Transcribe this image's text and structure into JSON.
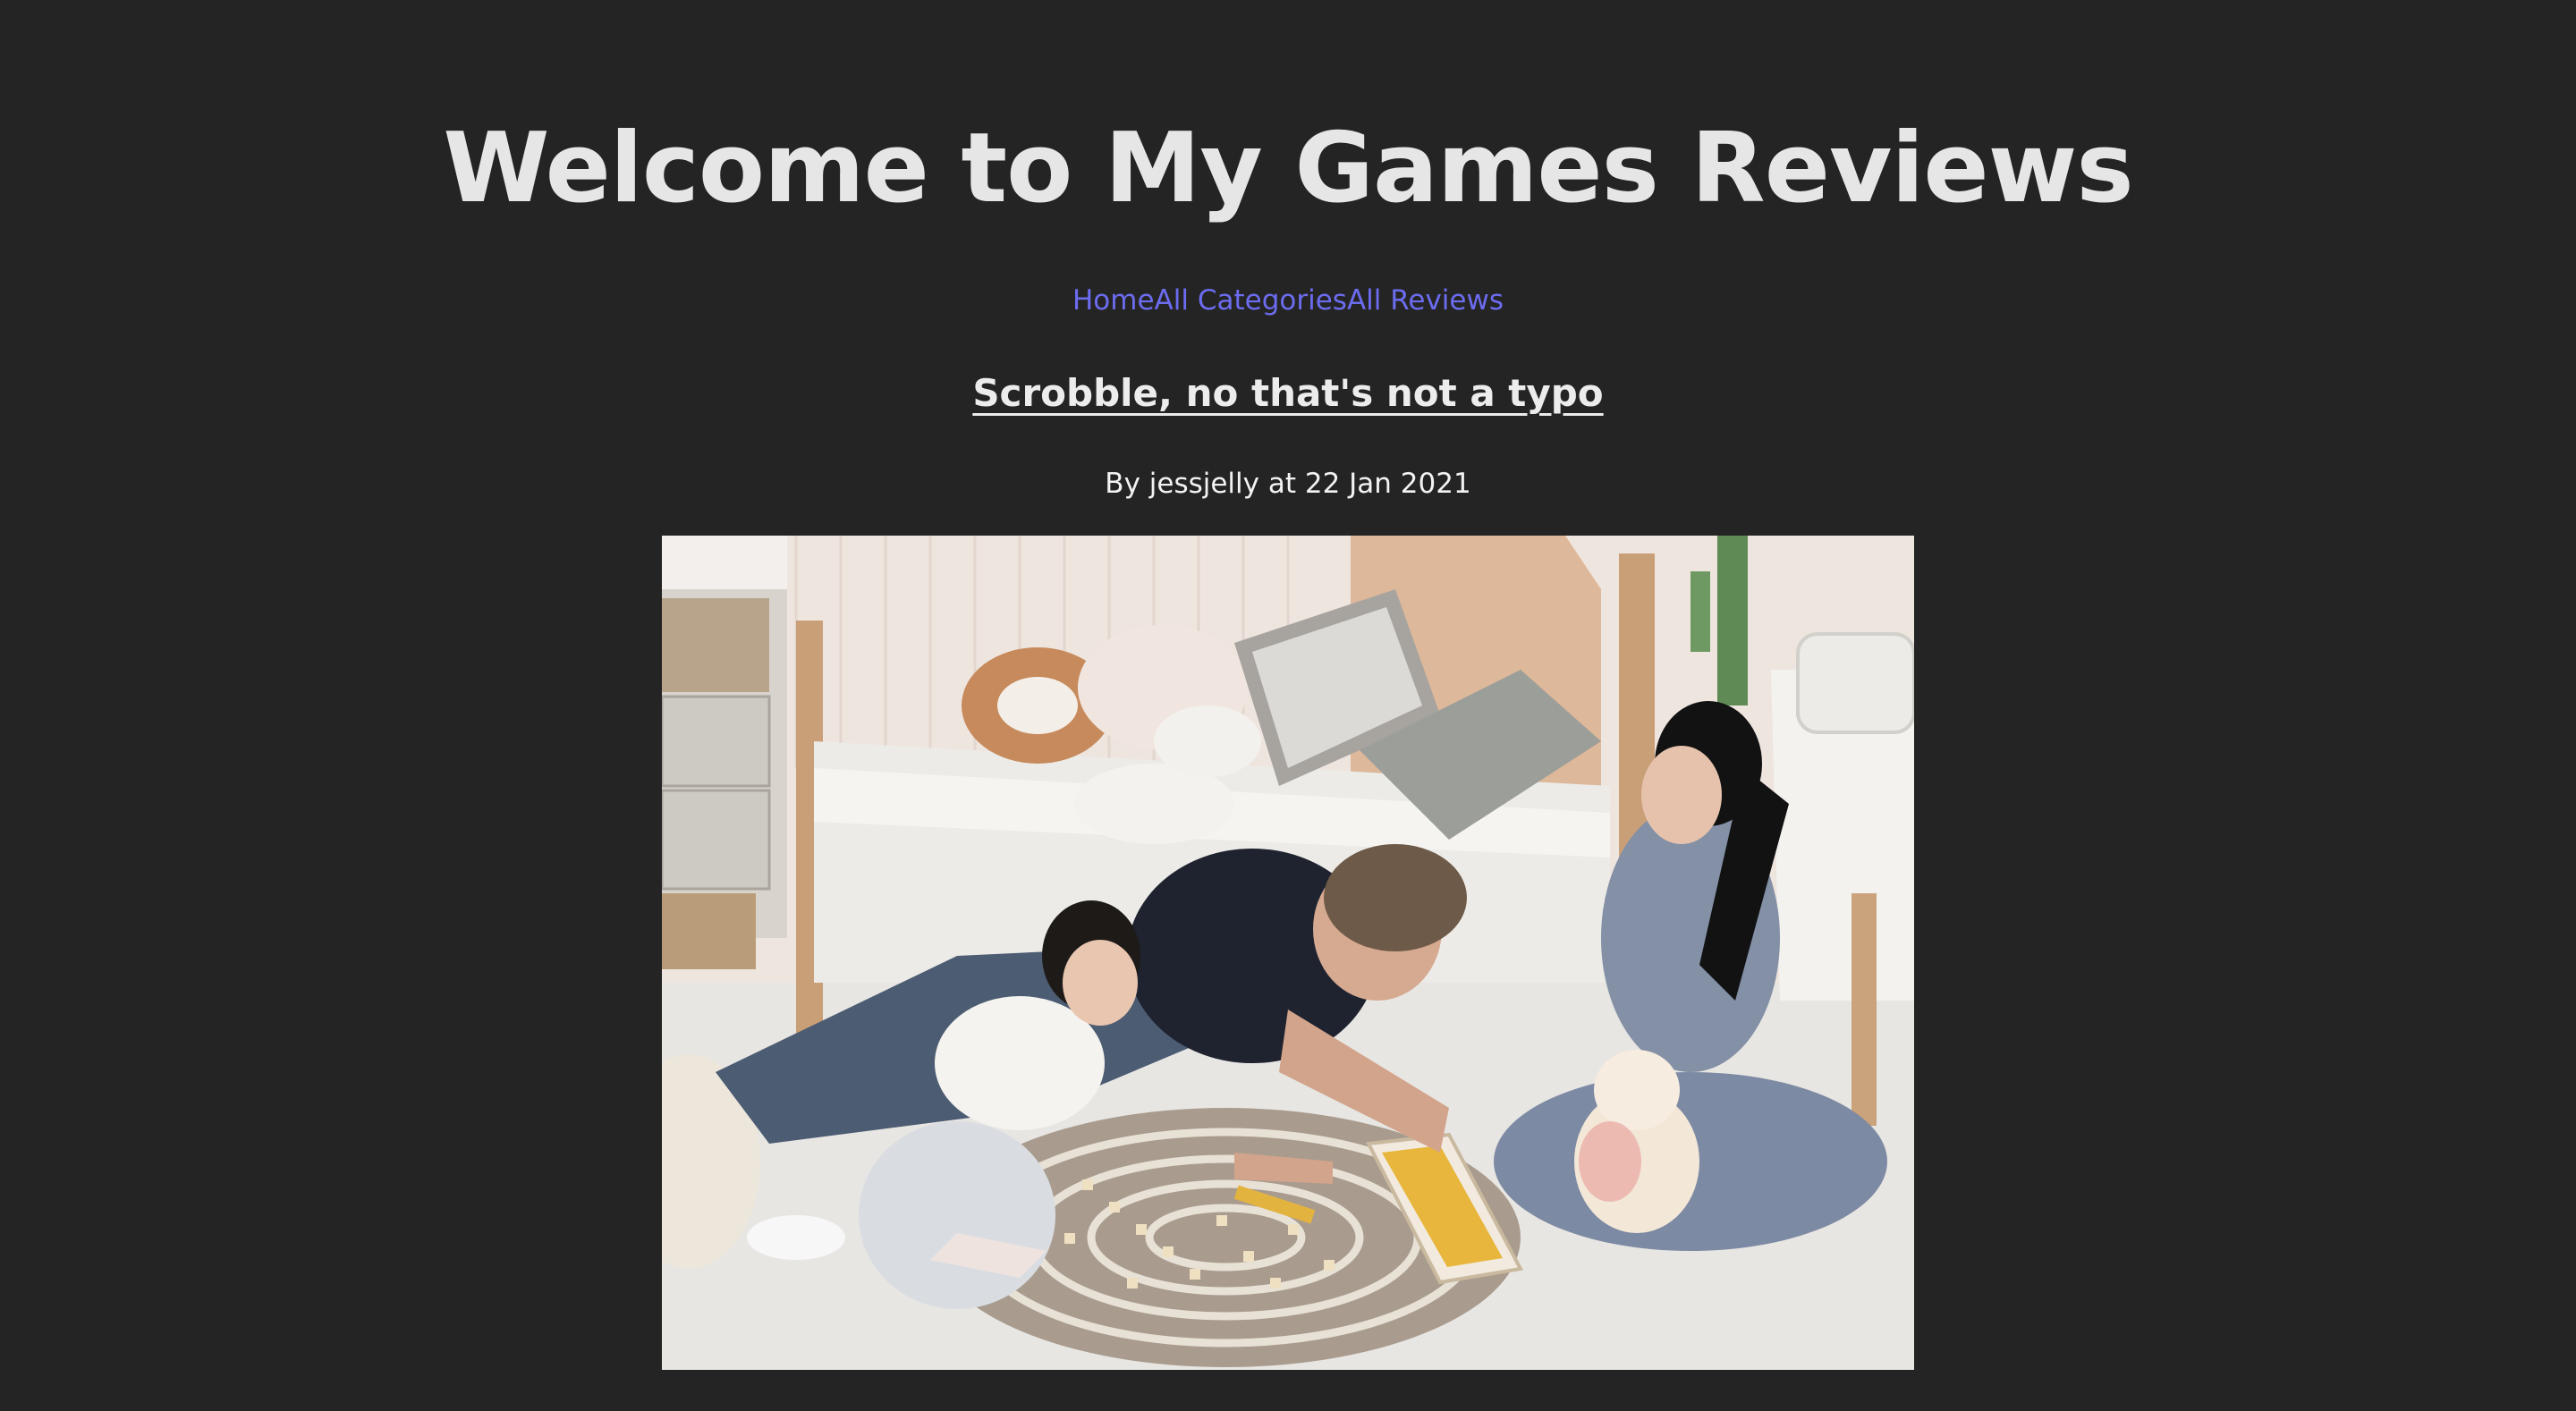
{
  "site": {
    "title": "Welcome to My Games Reviews"
  },
  "nav": {
    "items": [
      {
        "label": "Home"
      },
      {
        "label": "All Categories"
      },
      {
        "label": "All Reviews"
      }
    ]
  },
  "review": {
    "title": "Scrobble, no that's not a typo",
    "byline": "By jessjelly at 22 Jan 2021",
    "image": {
      "subject": "family-playing-word-tile-game-on-floor"
    }
  },
  "colors": {
    "background": "#242424",
    "title": "#e6e6e6",
    "link": "#6c6cf0",
    "text": "#f2f2f2"
  }
}
